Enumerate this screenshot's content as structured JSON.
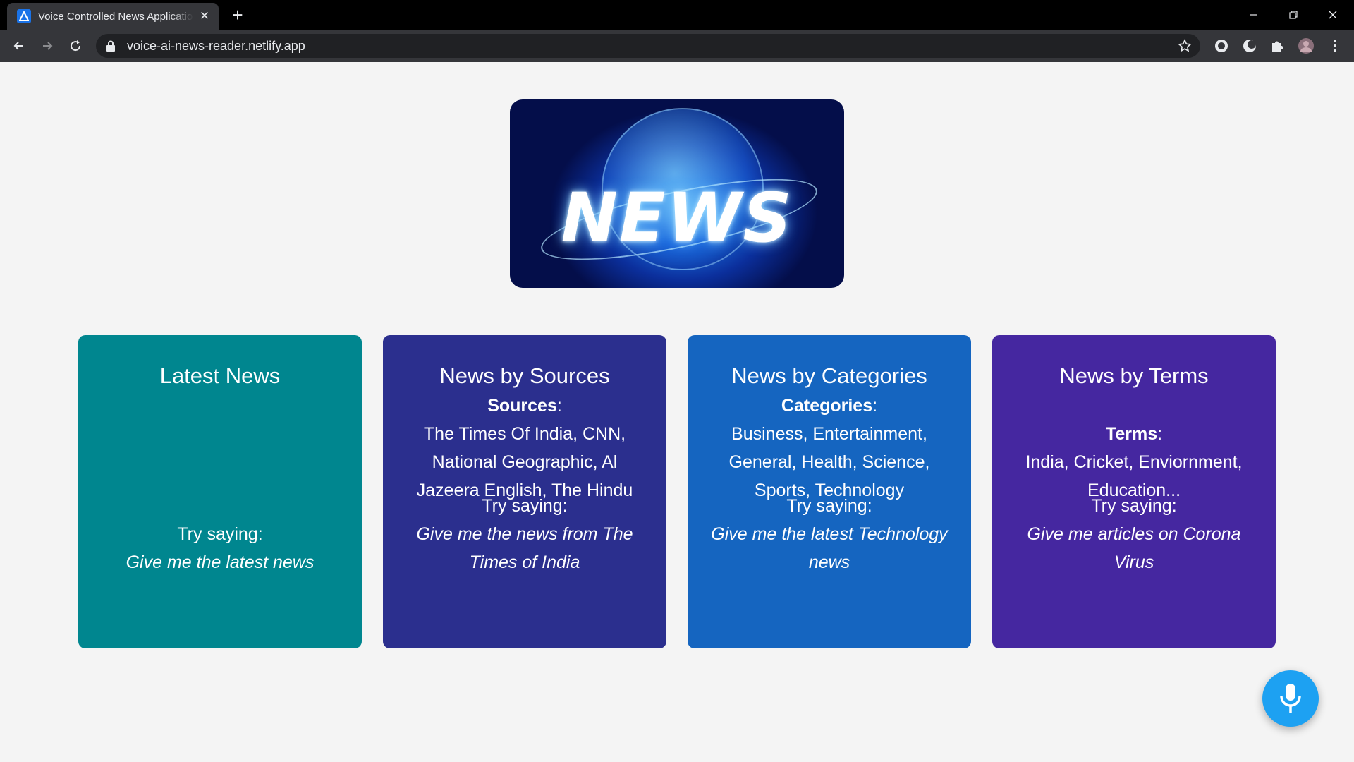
{
  "browser": {
    "tab_title": "Voice Controlled News Application",
    "new_tab_label": "+",
    "close_tab_label": "✕",
    "url": "voice-ai-news-reader.netlify.app"
  },
  "hero": {
    "text": "NEWS"
  },
  "cards": [
    {
      "title": "Latest News",
      "info_heading": "",
      "info_text": "",
      "try_label": "Try saying:",
      "try_example": "Give me the latest news",
      "color": "#00868f"
    },
    {
      "title": "News by Sources",
      "info_heading": "Sources",
      "info_text": "The Times Of India, CNN, National Geographic, Al Jazeera English, The Hindu",
      "try_label": "Try saying:",
      "try_example": "Give me the news from The Times of India",
      "color": "#2b2f8e"
    },
    {
      "title": "News by Categories",
      "info_heading": "Categories",
      "info_text": "Business, Entertainment, General, Health, Science, Sports, Technology",
      "try_label": "Try saying:",
      "try_example": "Give me the latest Technology news",
      "color": "#1565c0"
    },
    {
      "title": "News by Terms",
      "info_heading": "Terms",
      "info_text": "India, Cricket, Enviornment, Education...",
      "try_label": "Try saying:",
      "try_example": "Give me articles on Corona Virus",
      "color": "#4527a0"
    }
  ],
  "icons": {
    "mic": "microphone-icon",
    "back": "arrow-left-icon",
    "forward": "arrow-right-icon",
    "reload": "reload-icon",
    "lock": "lock-icon",
    "star": "star-icon",
    "extensions": "puzzle-icon"
  }
}
